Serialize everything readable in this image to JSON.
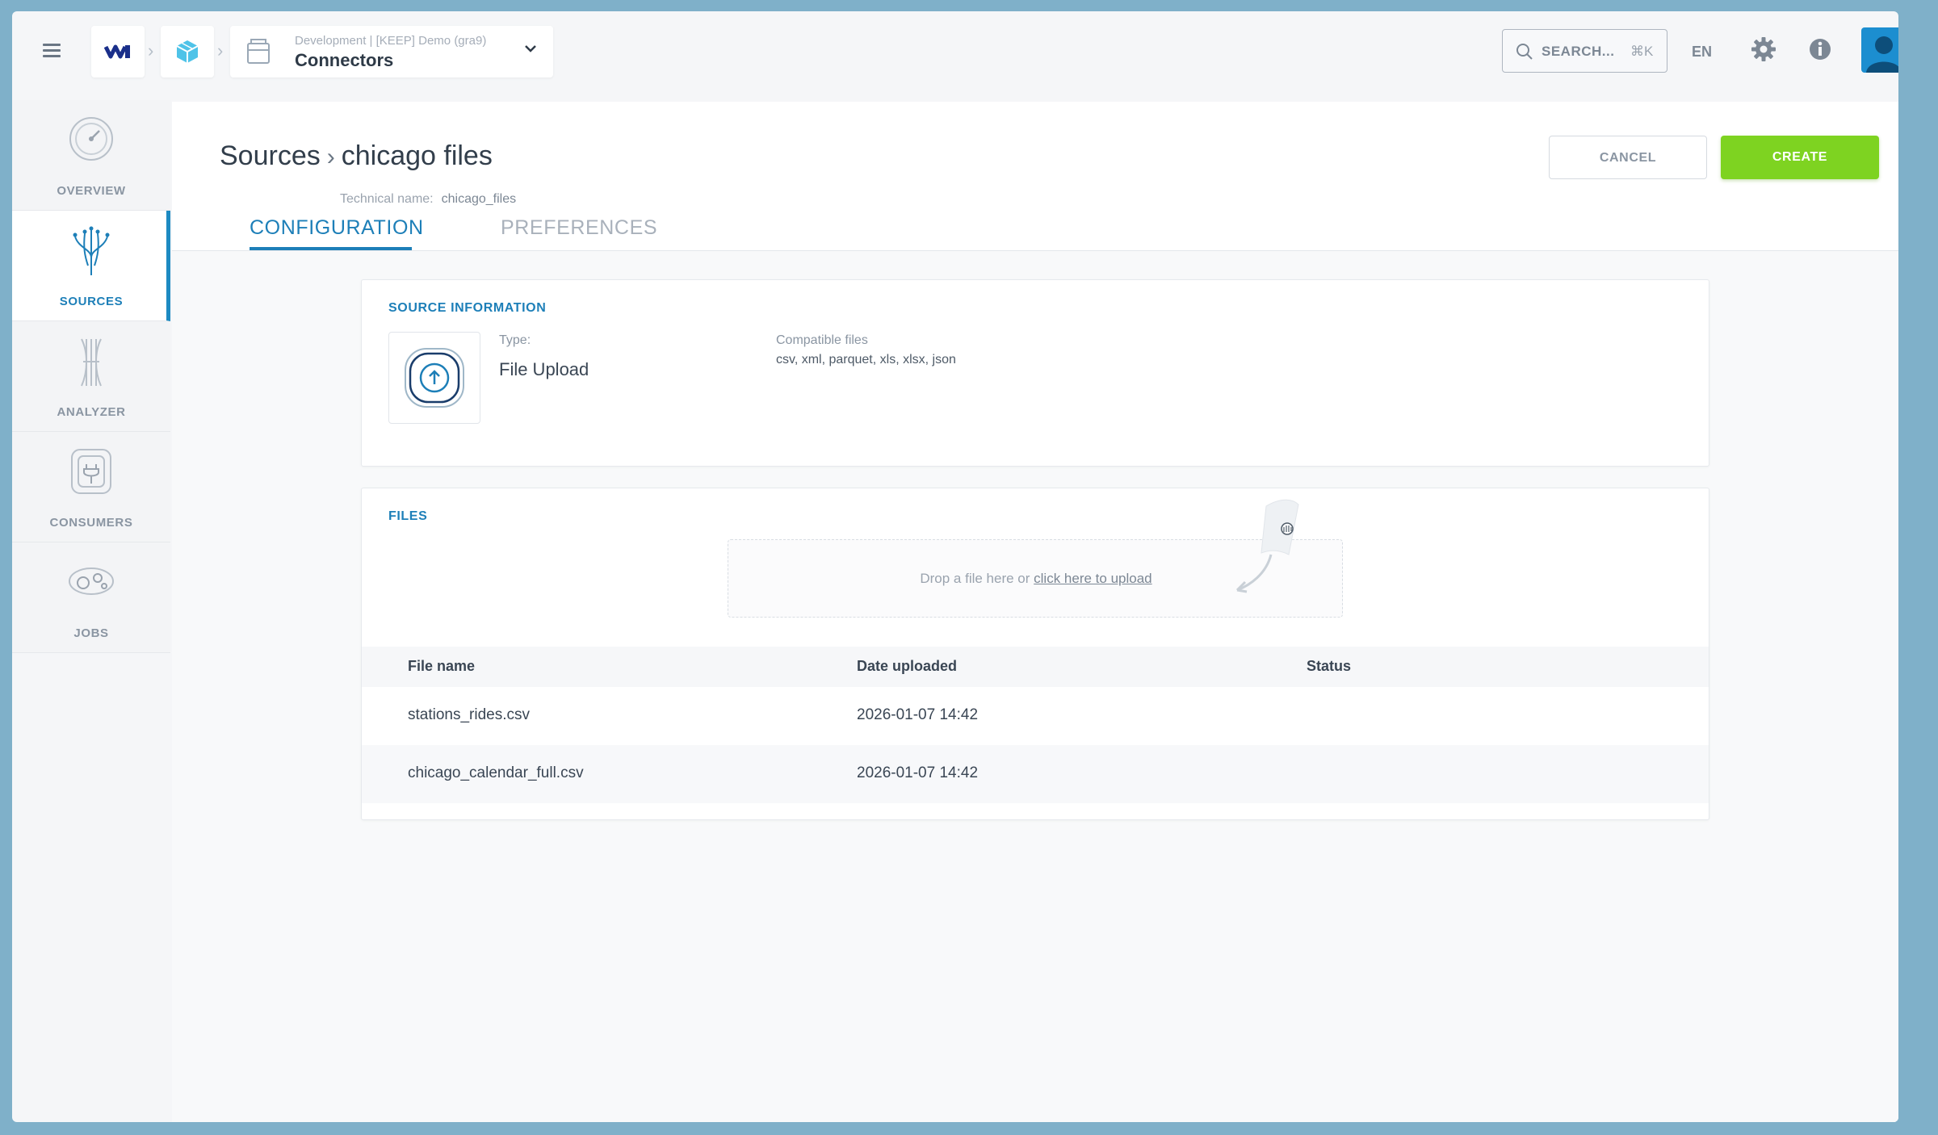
{
  "topbar": {
    "project_env": "Development | [KEEP] Demo (gra9)",
    "project_name": "Connectors",
    "search_placeholder": "SEARCH...",
    "search_shortcut": "⌘K",
    "language": "EN",
    "icons": [
      "menu-icon",
      "logo-icon",
      "cube-icon",
      "project-icon",
      "chevron-down-icon",
      "search-icon",
      "gear-icon",
      "info-icon",
      "avatar"
    ]
  },
  "sidebar": {
    "items": [
      {
        "label": "OVERVIEW",
        "icon": "gauge-icon",
        "active": false
      },
      {
        "label": "SOURCES",
        "icon": "sources-icon",
        "active": true
      },
      {
        "label": "ANALYZER",
        "icon": "analyzer-icon",
        "active": false
      },
      {
        "label": "CONSUMERS",
        "icon": "plug-icon",
        "active": false
      },
      {
        "label": "JOBS",
        "icon": "jobs-icon",
        "active": false
      }
    ]
  },
  "page": {
    "breadcrumb_parent": "Sources",
    "breadcrumb_current": "chicago files",
    "technical_name_label": "Technical name:",
    "technical_name_value": "chicago_files",
    "cancel_label": "CANCEL",
    "create_label": "CREATE",
    "tabs": [
      {
        "label": "CONFIGURATION",
        "active": true
      },
      {
        "label": "PREFERENCES",
        "active": false
      }
    ]
  },
  "source_info": {
    "title": "SOURCE INFORMATION",
    "type_label": "Type:",
    "type_value": "File Upload",
    "compat_label": "Compatible files",
    "compat_value": "csv, xml, parquet, xls, xlsx, json"
  },
  "files": {
    "title": "FILES",
    "drop_text": "Drop a file here  or ",
    "drop_link": "click here to upload",
    "columns": [
      "File name",
      "Date uploaded",
      "Status"
    ],
    "rows": [
      {
        "name": "stations_rides.csv",
        "date": "2026-01-07 14:42",
        "status": ""
      },
      {
        "name": "chicago_calendar_full.csv",
        "date": "2026-01-07 14:42",
        "status": ""
      }
    ]
  },
  "colors": {
    "accent": "#1d7fb8",
    "create_green": "#7ed321",
    "frame": "#7fb0c9"
  }
}
